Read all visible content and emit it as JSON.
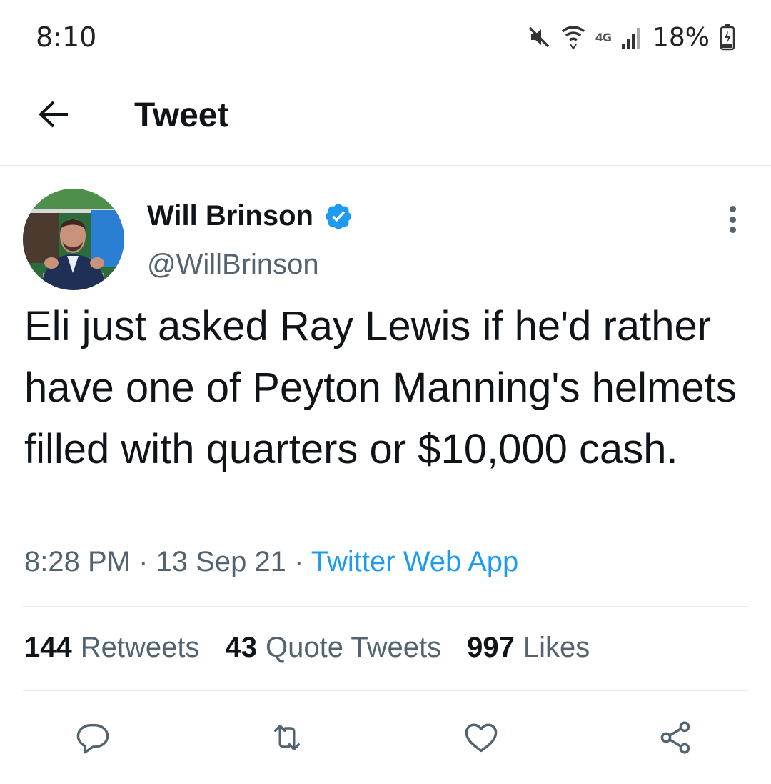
{
  "status_bar": {
    "time": "8:10",
    "network": "4G",
    "battery": "18%",
    "icons": [
      "mute-icon",
      "wifi-icon",
      "signal-icon",
      "battery-icon"
    ]
  },
  "header": {
    "back_icon": "arrow-left-icon",
    "title": "Tweet"
  },
  "tweet": {
    "author": {
      "name": "Will Brinson",
      "handle": "@WillBrinson",
      "verified": true
    },
    "text": "Eli just asked Ray Lewis if he'd rather have one of Peyton Manning's helmets filled with quarters or $10,000 cash.",
    "time": "8:28 PM",
    "date": "13 Sep 21",
    "source": "Twitter Web App",
    "separator": "·",
    "stats": {
      "retweets": {
        "count": "144",
        "label": "Retweets"
      },
      "quotes": {
        "count": "43",
        "label": "Quote Tweets"
      },
      "likes": {
        "count": "997",
        "label": "Likes"
      }
    },
    "actions": [
      "reply-icon",
      "retweet-icon",
      "like-icon",
      "share-icon"
    ]
  },
  "colors": {
    "text": "#0f1419",
    "secondary": "#536471",
    "accent": "#1d9bf0",
    "divider": "#e6ecf0"
  }
}
